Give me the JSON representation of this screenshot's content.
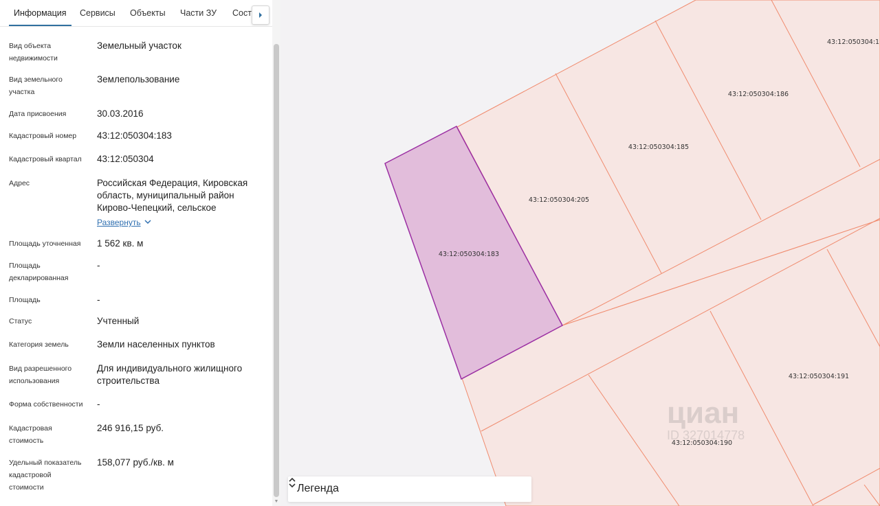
{
  "tabs": [
    "Информация",
    "Сервисы",
    "Объекты",
    "Части ЗУ",
    "Соста"
  ],
  "info": [
    {
      "label": "Вид объекта недвижимости",
      "value": "Земельный участок"
    },
    {
      "label": "Вид земельного участка",
      "value": "Землепользование"
    },
    {
      "label": "Дата присвоения",
      "value": "30.03.2016"
    },
    {
      "label": "Кадастровый номер",
      "value": "43:12:050304:183"
    },
    {
      "label": "Кадастровый квартал",
      "value": "43:12:050304"
    },
    {
      "label": "Адрес",
      "value": "Российская Федерация, Кировская область, муниципальный район Кирово-Чепецкий, сельское"
    },
    {
      "label": "Площадь уточненная",
      "value": "1 562 кв. м"
    },
    {
      "label": "Площадь декларированная",
      "value": "-"
    },
    {
      "label": "Площадь",
      "value": "-"
    },
    {
      "label": "Статус",
      "value": "Учтенный"
    },
    {
      "label": "Категория земель",
      "value": "Земли населенных пунктов"
    },
    {
      "label": "Вид разрешенного использования",
      "value": "Для индивидуального жилищного строительства"
    },
    {
      "label": "Форма собственности",
      "value": "-"
    },
    {
      "label": "Кадастровая стоимость",
      "value": "246 916,15 руб."
    },
    {
      "label": "Удельный показатель кадастровой стоимости",
      "value": "158,077 руб./кв. м"
    }
  ],
  "address_expand": "Развернуть",
  "map": {
    "parcels": [
      "43:12:050304:183",
      "43:12:050304:205",
      "43:12:050304:185",
      "43:12:050304:186",
      "43:12:050304:1",
      "43:12:050304:191",
      "43:12:050304:190"
    ],
    "selected_fill": "#e2bddb",
    "selected_stroke": "#9b2fa3",
    "parcel_fill": "#f7e6e3",
    "parcel_stroke": "#f08b6e"
  },
  "watermark": {
    "brand": "циан",
    "id": "ID 327014778"
  },
  "legend": {
    "title": "Легенда"
  },
  "icons": [
    "chevron-right-icon",
    "chevron-down-icon",
    "up-down-chevron-icon"
  ]
}
